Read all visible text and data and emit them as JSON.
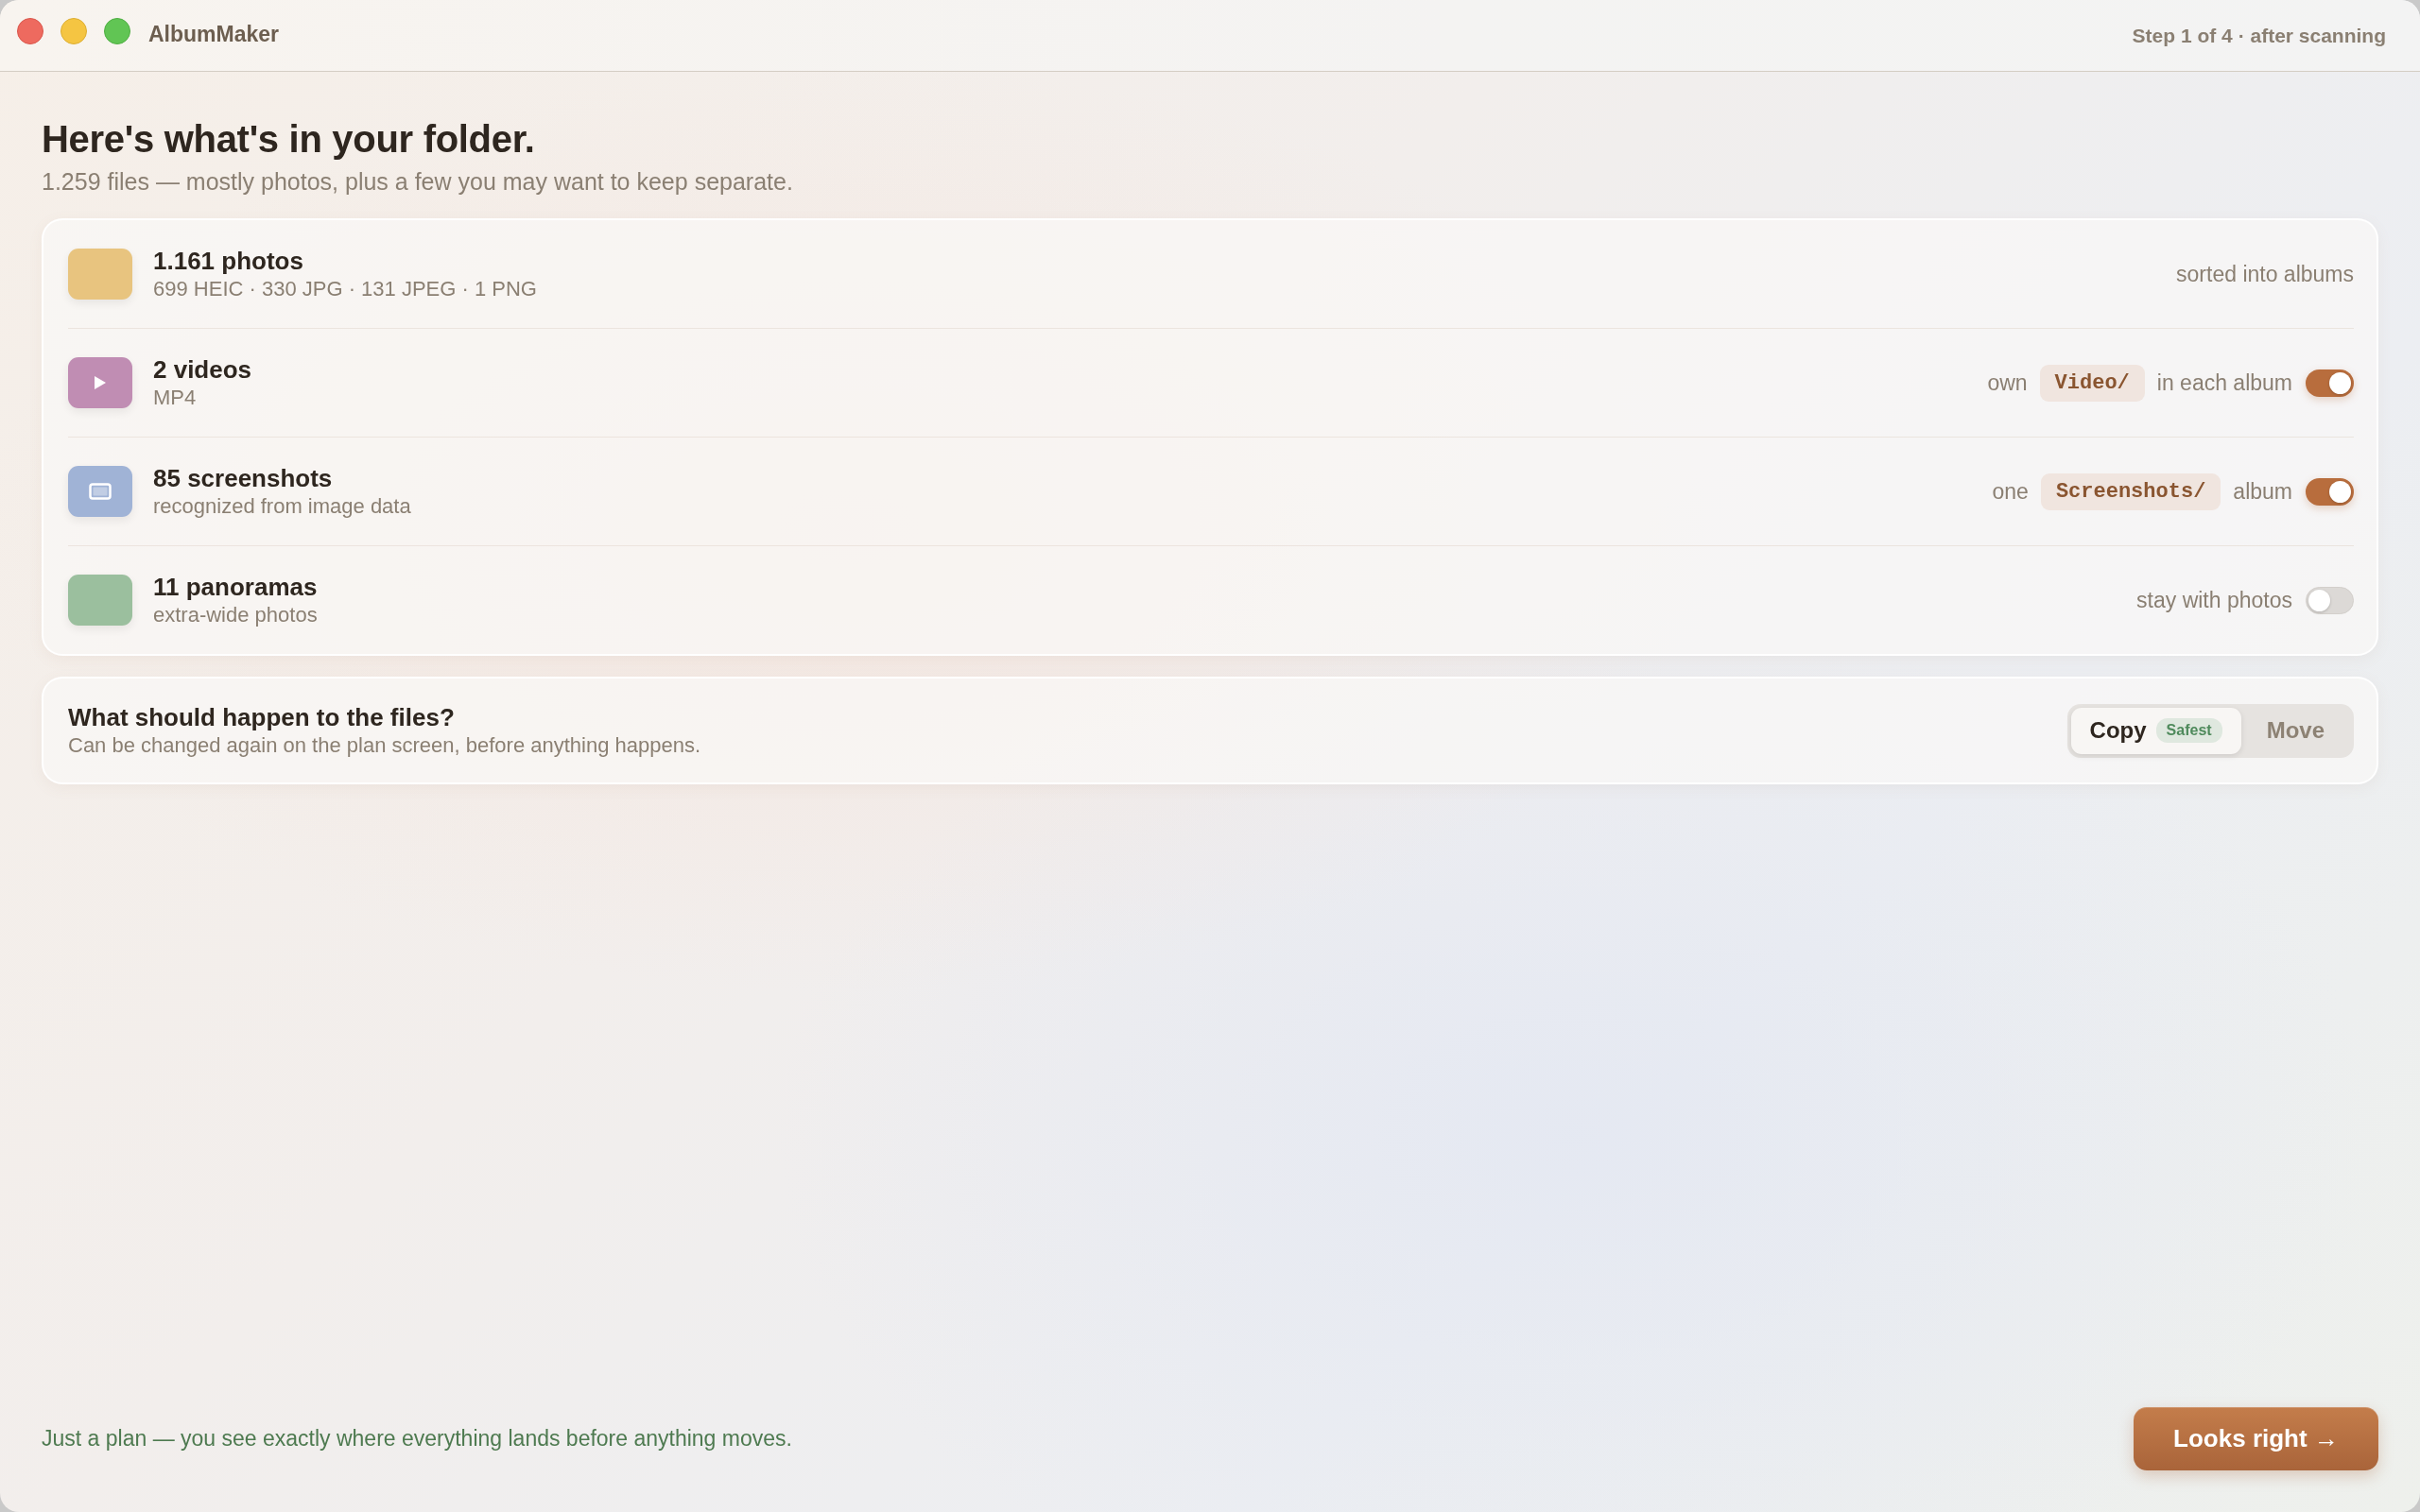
{
  "window": {
    "title": "AlbumMaker",
    "step": "Step 1 of 4 · after scanning"
  },
  "header": {
    "title": "Here's what's in your folder.",
    "subtitle": "1.259 files — mostly photos, plus a few you may want to keep separate."
  },
  "categories": [
    {
      "kind": "photo",
      "color": "#e8c47f",
      "title": "1.161 photos",
      "detail": "699 HEIC · 330 JPG · 131 JPEG · 1 PNG",
      "option": [
        {
          "kind": "text",
          "text": "sorted into albums"
        }
      ]
    },
    {
      "kind": "video",
      "color": "#c08db3",
      "title": "2 videos",
      "detail": "MP4",
      "option": [
        {
          "kind": "text",
          "text": "own"
        },
        {
          "kind": "folder",
          "text": "Video/"
        },
        {
          "kind": "text",
          "text": "in each album"
        }
      ],
      "toggle": {
        "on": true
      }
    },
    {
      "kind": "screenshot",
      "color": "#a0b3d6",
      "title": "85 screenshots",
      "detail": "recognized from image data",
      "option": [
        {
          "kind": "text",
          "text": "one"
        },
        {
          "kind": "folder",
          "text": "Screenshots/"
        },
        {
          "kind": "text",
          "text": "album"
        }
      ],
      "toggle": {
        "on": true
      }
    },
    {
      "kind": "panorama",
      "color": "#9bbf9e",
      "title": "11 panoramas",
      "detail": "extra-wide photos",
      "option": [
        {
          "kind": "text",
          "text": "stay with photos"
        }
      ],
      "toggle": {
        "on": false
      }
    }
  ],
  "file_action": {
    "title": "What should happen to the files?",
    "subtitle": "Can be changed again on the plan screen, before anything happens.",
    "options": [
      {
        "label": "Copy",
        "badge": "Safest",
        "selected": true
      },
      {
        "label": "Move",
        "selected": false
      }
    ]
  },
  "footer": {
    "note": "Just a plan — you see exactly where everything lands before anything moves.",
    "button": "Looks right →"
  }
}
